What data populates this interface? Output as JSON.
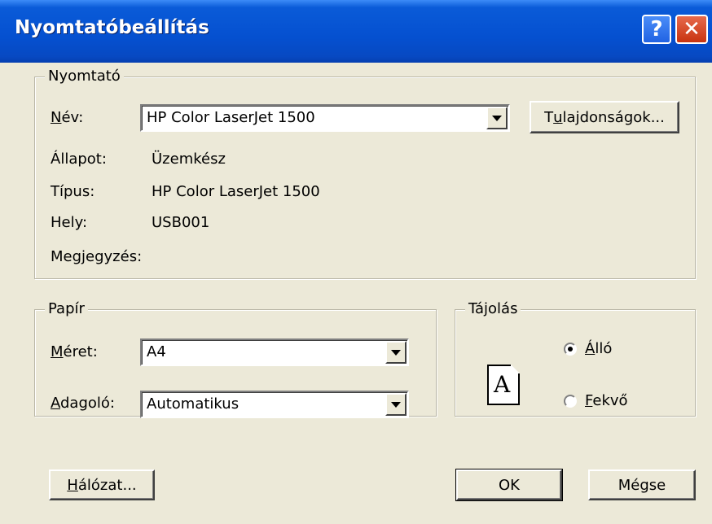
{
  "window": {
    "title": "Nyomtatóbeállítás",
    "help_glyph": "?",
    "close_glyph": "✕"
  },
  "printer_group": {
    "legend": "Nyomtató",
    "name_label_first": "N",
    "name_label_rest": "év:",
    "name_value": "HP Color LaserJet 1500",
    "properties_first": "T",
    "properties_underlined": "u",
    "properties_rest": "lajdonságok...",
    "status_label": "Állapot:",
    "status_value": "Üzemkész",
    "type_label": "Típus:",
    "type_value": "HP Color LaserJet 1500",
    "location_label": "Hely:",
    "location_value": "USB001",
    "comment_label": "Megjegyzés:"
  },
  "paper_group": {
    "legend": "Papír",
    "size_label_first": "M",
    "size_label_rest": "éret:",
    "size_value": "A4",
    "source_label_first": "A",
    "source_label_rest": "dagoló:",
    "source_value": "Automatikus"
  },
  "orientation_group": {
    "legend": "Tájolás",
    "icon_letter": "A",
    "portrait_first": "Á",
    "portrait_rest": "lló",
    "portrait_selected": true,
    "landscape_first": "F",
    "landscape_rest": "ekvő",
    "landscape_selected": false
  },
  "buttons": {
    "network_first": "H",
    "network_rest": "álózat...",
    "ok": "OK",
    "cancel": "Mégse"
  }
}
